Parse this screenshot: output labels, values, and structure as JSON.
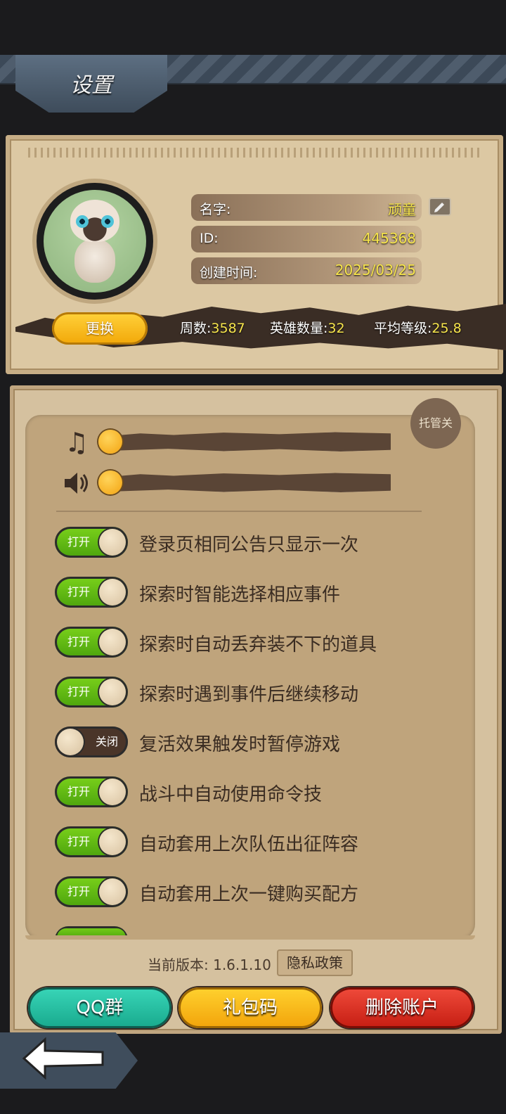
{
  "header": {
    "title": "设置"
  },
  "profile": {
    "name_label": "名字:",
    "name_value": "顽童",
    "id_label": "ID:",
    "id_value": "445368",
    "created_label": "创建时间:",
    "created_value": "2025/03/25",
    "change_button": "更换",
    "stats": {
      "weeks_label": "周数:",
      "weeks_value": "3587",
      "heroes_label": "英雄数量:",
      "heroes_value": "32",
      "avg_level_label": "平均等级:",
      "avg_level_value": "25.8"
    }
  },
  "settings": {
    "autoplay_button": "托管关",
    "music_icon": "music-note-icon",
    "sound_icon": "speaker-icon",
    "music_volume": 0,
    "sound_volume": 0,
    "options": [
      {
        "state": "打开",
        "label": "登录页相同公告只显示一次",
        "on": true
      },
      {
        "state": "打开",
        "label": "探索时智能选择相应事件",
        "on": true
      },
      {
        "state": "打开",
        "label": "探索时自动丢弃装不下的道具",
        "on": true
      },
      {
        "state": "打开",
        "label": "探索时遇到事件后继续移动",
        "on": true
      },
      {
        "state": "关闭",
        "label": "复活效果触发时暂停游戏",
        "on": false
      },
      {
        "state": "打开",
        "label": "战斗中自动使用命令技",
        "on": true
      },
      {
        "state": "打开",
        "label": "自动套用上次队伍出征阵容",
        "on": true
      },
      {
        "state": "打开",
        "label": "自动套用上次一键购买配方",
        "on": true
      }
    ]
  },
  "footer": {
    "version_text": "当前版本: 1.6.1.10",
    "privacy_button": "隐私政策",
    "qq_button": "QQ群",
    "gift_button": "礼包码",
    "delete_button": "删除账户"
  }
}
